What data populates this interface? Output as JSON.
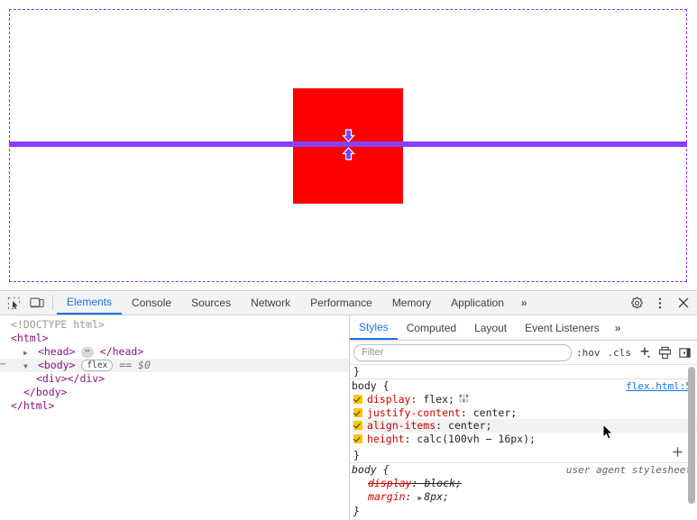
{
  "viewport": {
    "name": "rendered-page-flex-overlay",
    "container_outline_color": "#7c3aed",
    "flex_item_color": "#ff0000",
    "align_line_color": "#8a3ffc",
    "align_arrow_icons": [
      "arrow-down-icon",
      "arrow-up-icon"
    ]
  },
  "devtools": {
    "toolbar": {
      "inspect_icon": "inspect-element-icon",
      "device_icon": "device-toolbar-icon",
      "settings_icon": "gear-icon",
      "more_icon": "kebab-menu-icon",
      "close_icon": "close-icon",
      "tabs": [
        {
          "label": "Elements",
          "active": true
        },
        {
          "label": "Console",
          "active": false
        },
        {
          "label": "Sources",
          "active": false
        },
        {
          "label": "Network",
          "active": false
        },
        {
          "label": "Performance",
          "active": false
        },
        {
          "label": "Memory",
          "active": false
        },
        {
          "label": "Application",
          "active": false
        }
      ],
      "more_tabs_label": "»"
    },
    "dom_tree": [
      {
        "indent": 0,
        "text": "<!DOCTYPE html>",
        "kind": "doctype"
      },
      {
        "indent": 0,
        "text": "<html>",
        "kind": "tag"
      },
      {
        "indent": 1,
        "text": "<head>",
        "close": "</head>",
        "kind": "collapsed"
      },
      {
        "indent": 1,
        "text": "<body>",
        "badge": "flex",
        "suffix": "== $0",
        "kind": "selected"
      },
      {
        "indent": 2,
        "text": "<div></div>",
        "kind": "tag"
      },
      {
        "indent": 1,
        "text": "</body>",
        "kind": "tag"
      },
      {
        "indent": 0,
        "text": "</html>",
        "kind": "tag"
      }
    ],
    "styles": {
      "tabs": [
        {
          "label": "Styles",
          "active": true
        },
        {
          "label": "Computed",
          "active": false
        },
        {
          "label": "Layout",
          "active": false
        },
        {
          "label": "Event Listeners",
          "active": false
        }
      ],
      "more_tabs_label": "»",
      "filter_placeholder": "Filter",
      "filter_value": "",
      "hov_label": ":hov",
      "cls_label": ".cls",
      "new_rule_icon": "plus-new-style-rule-icon",
      "print_icon": "toggle-print-media-icon",
      "sidebar_icon": "computed-sidebar-toggle-icon",
      "truncated_brace": "}",
      "rules": [
        {
          "selector": "body {",
          "origin": "flex.html:5",
          "origin_is_link": true,
          "close": "}",
          "declarations": [
            {
              "checked": true,
              "property": "display",
              "value": "flex;",
              "badge": "flex-grid-badge-icon",
              "struck": false
            },
            {
              "checked": true,
              "property": "justify-content",
              "value": "center;",
              "struck": false
            },
            {
              "checked": true,
              "property": "align-items",
              "value": "center;",
              "struck": false,
              "hovered": true
            },
            {
              "checked": true,
              "property": "height",
              "value": "calc(100vh − 16px);",
              "struck": false
            }
          ]
        },
        {
          "selector": "body {",
          "origin": "user agent stylesheet",
          "origin_is_link": false,
          "user_agent": true,
          "close": "}",
          "declarations": [
            {
              "checked": false,
              "property": "display",
              "value": "block;",
              "struck": true
            },
            {
              "checked": false,
              "property": "margin",
              "value": "8px;",
              "struck": false,
              "expander": "▶"
            }
          ]
        }
      ],
      "add_declaration_icon": "plus-icon"
    }
  }
}
